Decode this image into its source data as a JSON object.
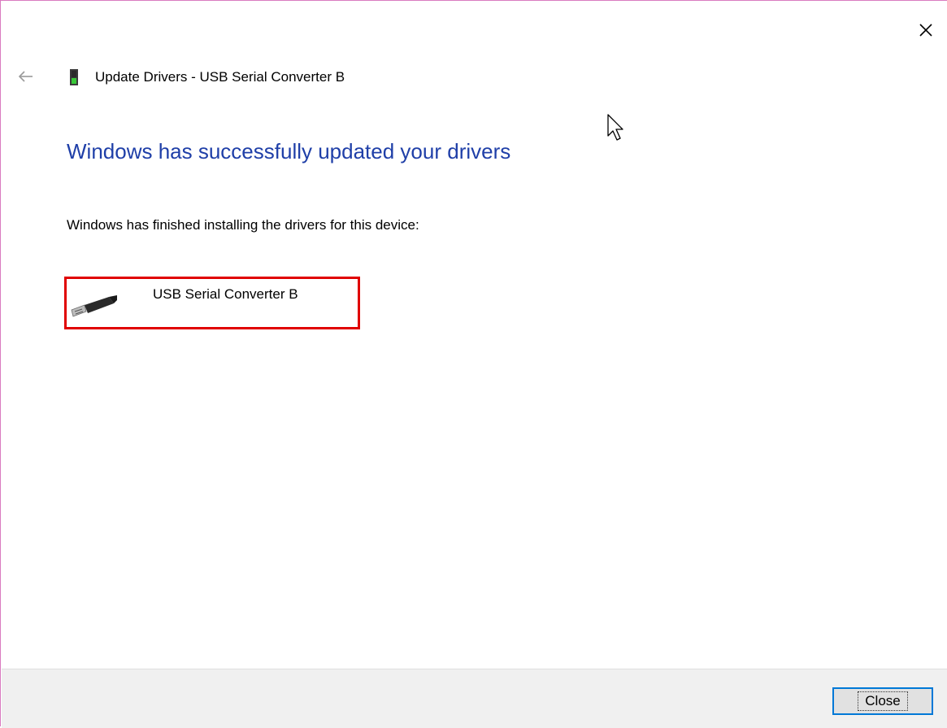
{
  "window": {
    "title": "Update Drivers - USB Serial Converter B",
    "accent_color": "#1f3fa8",
    "highlight_color": "#e00000"
  },
  "main": {
    "heading": "Windows has successfully updated your drivers",
    "message": "Windows has finished installing the drivers for this device:",
    "device": {
      "name": "USB Serial Converter B",
      "icon": "usb-plug-icon"
    }
  },
  "footer": {
    "close_label": "Close"
  },
  "icons": {
    "close": "close-icon",
    "back": "back-arrow-icon",
    "device": "device-icon",
    "cursor": "mouse-cursor-icon"
  }
}
